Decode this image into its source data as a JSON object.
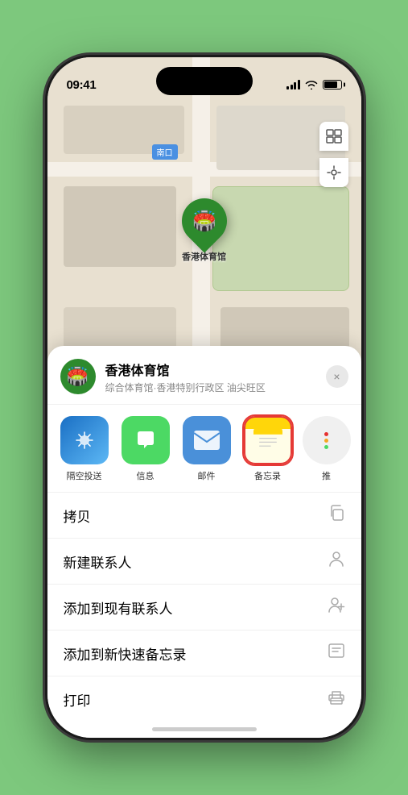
{
  "phone": {
    "time": "09:41",
    "map_label": "南口",
    "stadium_pin_label": "香港体育馆",
    "venue": {
      "name": "香港体育馆",
      "subtitle": "综合体育馆·香港特别行政区 油尖旺区",
      "close_label": "×"
    },
    "share_apps": [
      {
        "id": "airdrop",
        "label": "隔空投送"
      },
      {
        "id": "messages",
        "label": "信息"
      },
      {
        "id": "mail",
        "label": "邮件"
      },
      {
        "id": "notes",
        "label": "备忘录"
      }
    ],
    "actions": [
      {
        "label": "拷贝",
        "icon": "copy"
      },
      {
        "label": "新建联系人",
        "icon": "person"
      },
      {
        "label": "添加到现有联系人",
        "icon": "person-add"
      },
      {
        "label": "添加到新快速备忘录",
        "icon": "note"
      },
      {
        "label": "打印",
        "icon": "printer"
      }
    ]
  }
}
